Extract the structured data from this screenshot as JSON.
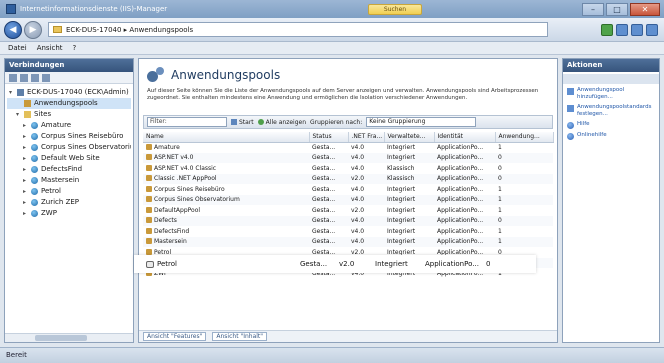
{
  "window": {
    "title": "Internetinformationsdienste (IIS)-Manager",
    "search_text": "Suchen",
    "minimize": "–",
    "maximize": "□",
    "close": "✕"
  },
  "address": {
    "back": "◀",
    "forward": "▶",
    "path": "ECK-DUS-17040  ▸  Anwendungspools"
  },
  "menu": [
    "Datei",
    "Ansicht",
    "?"
  ],
  "connections": {
    "header": "Verbindungen",
    "tree": [
      {
        "label": "ECK-DUS-17040 (ECK\\Admin)",
        "icon": "server",
        "expander": "▾",
        "indent": 0
      },
      {
        "label": "Anwendungspools",
        "icon": "pool",
        "expander": "",
        "indent": 1,
        "selected": true
      },
      {
        "label": "Sites",
        "icon": "folder",
        "expander": "▾",
        "indent": 1
      },
      {
        "label": "Amature",
        "icon": "globe",
        "expander": "▸",
        "indent": 2
      },
      {
        "label": "Corpus Sines Reisebüro",
        "icon": "globe",
        "expander": "▸",
        "indent": 2
      },
      {
        "label": "Corpus Sines Observatorium",
        "icon": "globe",
        "expander": "▸",
        "indent": 2
      },
      {
        "label": "Default Web Site",
        "icon": "globe",
        "expander": "▸",
        "indent": 2
      },
      {
        "label": "DefectsFind",
        "icon": "globe",
        "expander": "▸",
        "indent": 2
      },
      {
        "label": "Mastersein",
        "icon": "globe",
        "expander": "▸",
        "indent": 2
      },
      {
        "label": "Petrol",
        "icon": "globe",
        "expander": "▸",
        "indent": 2
      },
      {
        "label": "Zurich ZEP",
        "icon": "globe",
        "expander": "▸",
        "indent": 2
      },
      {
        "label": "ZWP",
        "icon": "globe",
        "expander": "▸",
        "indent": 2
      }
    ]
  },
  "main": {
    "title": "Anwendungspools",
    "description": "Auf dieser Seite können Sie die Liste der Anwendungspools auf dem Server anzeigen und verwalten. Anwendungspools sind Arbeitsprozessen zugeordnet. Sie enthalten mindestens eine Anwendung und ermöglichen die Isolation verschiedener Anwendungen.",
    "filter": {
      "placeholder": "Filter:",
      "start": "Start",
      "show_all": "Alle anzeigen",
      "group_by": "Gruppieren nach:",
      "group_value": "Keine Gruppierung"
    },
    "columns": [
      "Name",
      "Status",
      ".NET Fra...",
      "Verwaltete...",
      "Identität",
      "Anwendung..."
    ],
    "rows": [
      [
        "Amature",
        "Gesta...",
        "v4.0",
        "Integriert",
        "ApplicationPo...",
        "1"
      ],
      [
        "ASP.NET v4.0",
        "Gesta...",
        "v4.0",
        "Integriert",
        "ApplicationPo...",
        "0"
      ],
      [
        "ASP.NET v4.0 Classic",
        "Gesta...",
        "v4.0",
        "Klassisch",
        "ApplicationPo...",
        "0"
      ],
      [
        "Classic .NET AppPool",
        "Gesta...",
        "v2.0",
        "Klassisch",
        "ApplicationPo...",
        "0"
      ],
      [
        "Corpus Sines Reisebüro",
        "Gesta...",
        "v4.0",
        "Integriert",
        "ApplicationPo...",
        "1"
      ],
      [
        "Corpus Sines Observatorium",
        "Gesta...",
        "v4.0",
        "Integriert",
        "ApplicationPo...",
        "1"
      ],
      [
        "DefaultAppPool",
        "Gesta...",
        "v2.0",
        "Integriert",
        "ApplicationPo...",
        "1"
      ],
      [
        "Defects",
        "Gesta...",
        "v4.0",
        "Integriert",
        "ApplicationPo...",
        "0"
      ],
      [
        "DefectsFind",
        "Gesta...",
        "v4.0",
        "Integriert",
        "ApplicationPo...",
        "1"
      ],
      [
        "Mastersein",
        "Gesta...",
        "v4.0",
        "Integriert",
        "ApplicationPo...",
        "1"
      ],
      [
        "Petrol",
        "Gesta...",
        "v2.0",
        "Integriert",
        "ApplicationPo...",
        "0"
      ],
      [
        "Zurich ZEP",
        "Gesta...",
        "v4.0",
        "Integriert",
        "ApplicationPo...",
        "1"
      ],
      [
        "ZWP",
        "Gesta...",
        "v4.0",
        "Integriert",
        "ApplicationPo...",
        "1"
      ]
    ],
    "footer": {
      "features": "Ansicht \"Features\"",
      "content": "Ansicht \"Inhalt\""
    }
  },
  "highlight": {
    "name": "Petrol",
    "status": "Gesta...",
    "net": "v2.0",
    "mode": "Integriert",
    "identity": "ApplicationPo...",
    "apps": "0"
  },
  "actions": {
    "header": "Aktionen",
    "items": [
      {
        "label": "Anwendungspool hinzufügen...",
        "icon": "add"
      },
      {
        "label": "Anwendungspoolstandards festlegen...",
        "icon": "add"
      },
      {
        "label": "Hilfe",
        "icon": "help"
      },
      {
        "label": "Onlinehilfe",
        "icon": "help"
      }
    ]
  },
  "status": {
    "text": "Bereit"
  },
  "colors": {
    "title_bar": "#8faacb",
    "pane_header": "#43628c",
    "link": "#1f56a8",
    "highlight_bg": "#ffffff"
  }
}
